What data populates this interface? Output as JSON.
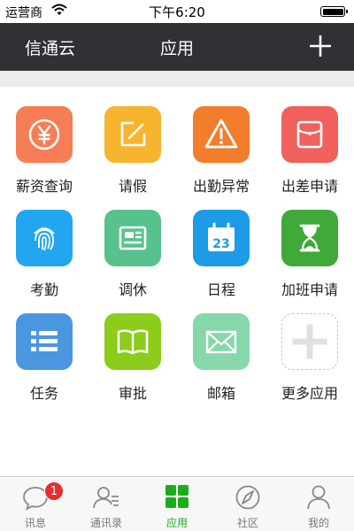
{
  "status_bar": {
    "carrier": "运营商",
    "time": "下午6:20",
    "wifi_icon": "wifi-icon",
    "battery_icon": "battery-icon"
  },
  "nav": {
    "left_title": "信通云",
    "title": "应用",
    "add_icon": "plus-icon"
  },
  "apps": [
    {
      "label": "薪资查询",
      "icon": "yen-coin-icon",
      "color": "#f57e56"
    },
    {
      "label": "请假",
      "icon": "edit-pencil-icon",
      "color": "#f7b52f"
    },
    {
      "label": "出勤异常",
      "icon": "warning-triangle-icon",
      "color": "#f27d2d"
    },
    {
      "label": "出差申请",
      "icon": "briefcase-icon",
      "color": "#f0615e"
    },
    {
      "label": "考勤",
      "icon": "fingerprint-icon",
      "color": "#22a6f0"
    },
    {
      "label": "调休",
      "icon": "newspaper-icon",
      "color": "#57c28b"
    },
    {
      "label": "日程",
      "icon": "calendar-icon",
      "color": "#1e9be6",
      "icon_text": "23"
    },
    {
      "label": "加班申请",
      "icon": "hourglass-icon",
      "color": "#3fa93a"
    },
    {
      "label": "任务",
      "icon": "list-icon",
      "color": "#4a97e0"
    },
    {
      "label": "审批",
      "icon": "open-book-icon",
      "color": "#8ccc1a"
    },
    {
      "label": "邮箱",
      "icon": "envelope-icon",
      "color": "#86d7aa"
    },
    {
      "label": "更多应用",
      "icon": "add-more-icon",
      "color": "#ffffff"
    }
  ],
  "tabs": [
    {
      "label": "讯息",
      "icon": "chat-bubble-icon",
      "badge": "1"
    },
    {
      "label": "通讯录",
      "icon": "contacts-icon"
    },
    {
      "label": "应用",
      "icon": "apps-grid-icon",
      "active": true
    },
    {
      "label": "社区",
      "icon": "compass-icon"
    },
    {
      "label": "我的",
      "icon": "person-icon"
    }
  ],
  "colors": {
    "nav_background": "#2f3134",
    "active_tab": "#1aad19",
    "inactive_tab": "#777777",
    "badge": "#e62e2e"
  }
}
